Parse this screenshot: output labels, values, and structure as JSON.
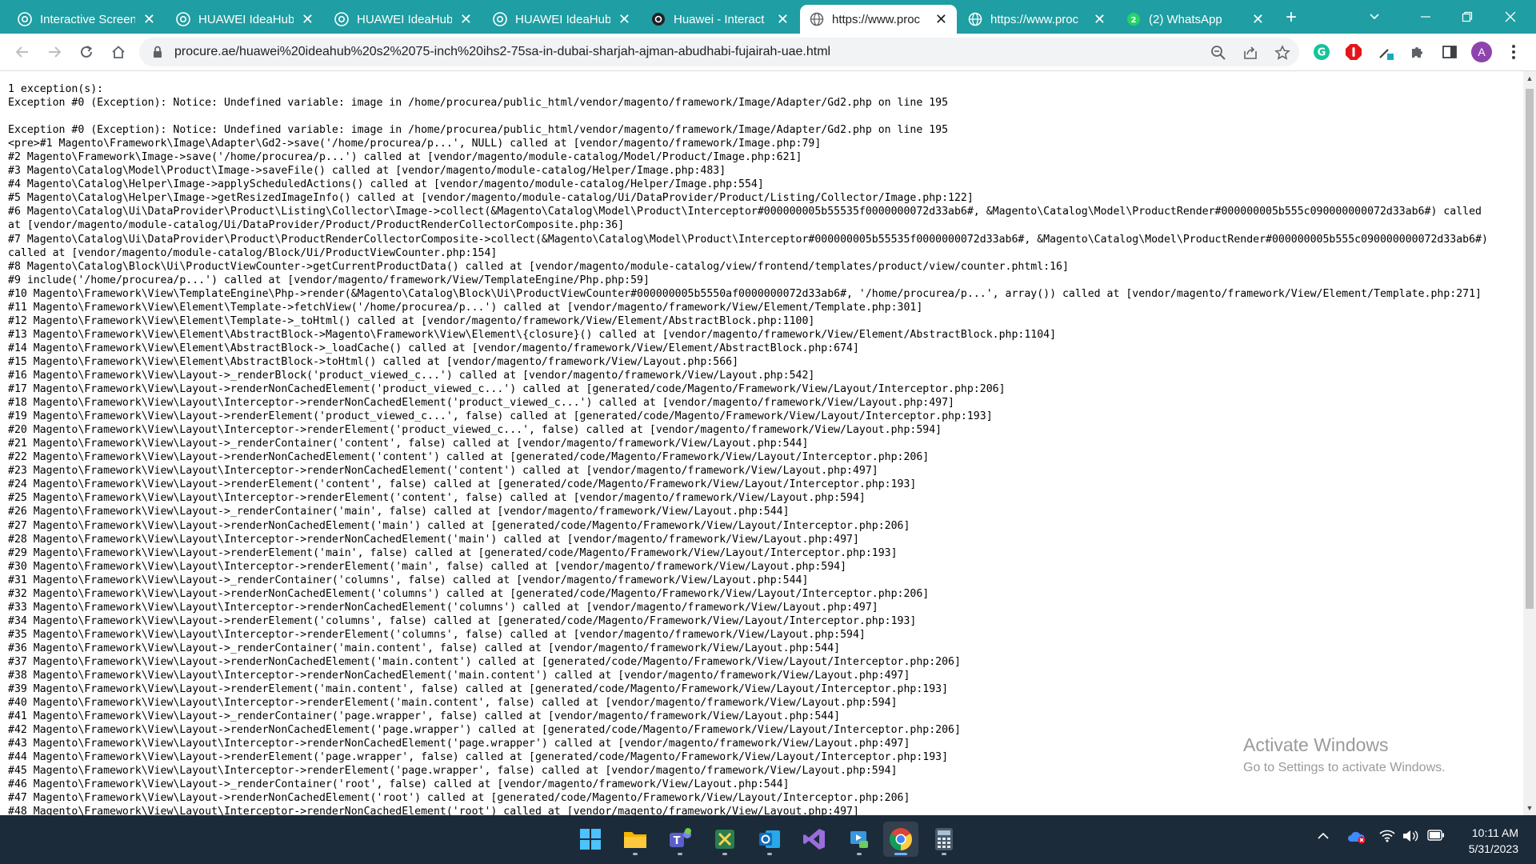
{
  "browser": {
    "tabs": [
      {
        "title": "Interactive Screen",
        "favicon": "chrome-icon",
        "active": false
      },
      {
        "title": "HUAWEI IdeaHub",
        "favicon": "chrome-icon",
        "active": false
      },
      {
        "title": "HUAWEI IdeaHub",
        "favicon": "chrome-icon",
        "active": false
      },
      {
        "title": "HUAWEI IdeaHub",
        "favicon": "chrome-icon",
        "active": false
      },
      {
        "title": "Huawei - Interact",
        "favicon": "site-icon",
        "active": false
      },
      {
        "title": "https://www.proc",
        "favicon": "globe-icon",
        "active": true
      },
      {
        "title": "https://www.proc",
        "favicon": "globe-icon",
        "active": false
      },
      {
        "title": "(2) WhatsApp",
        "favicon": "whatsapp-icon",
        "active": false
      }
    ],
    "new_tab_label": "+",
    "tab_close_glyph": "✕",
    "address": "procure.ae/huawei%20ideahub%20s2%2075-inch%20ihs2-75sa-in-dubai-sharjah-ajman-abudhabi-fujairah-uae.html",
    "profile_initial": "A"
  },
  "page": {
    "lines": [
      "1 exception(s):",
      "Exception #0 (Exception): Notice: Undefined variable: image in /home/procurea/public_html/vendor/magento/framework/Image/Adapter/Gd2.php on line 195",
      "",
      "Exception #0 (Exception): Notice: Undefined variable: image in /home/procurea/public_html/vendor/magento/framework/Image/Adapter/Gd2.php on line 195",
      "<pre>#1 Magento\\Framework\\Image\\Adapter\\Gd2->save('/home/procurea/p...', NULL) called at [vendor/magento/framework/Image.php:79]",
      "#2 Magento\\Framework\\Image->save('/home/procurea/p...') called at [vendor/magento/module-catalog/Model/Product/Image.php:621]",
      "#3 Magento\\Catalog\\Model\\Product\\Image->saveFile() called at [vendor/magento/module-catalog/Helper/Image.php:483]",
      "#4 Magento\\Catalog\\Helper\\Image->applyScheduledActions() called at [vendor/magento/module-catalog/Helper/Image.php:554]",
      "#5 Magento\\Catalog\\Helper\\Image->getResizedImageInfo() called at [vendor/magento/module-catalog/Ui/DataProvider/Product/Listing/Collector/Image.php:122]",
      "#6 Magento\\Catalog\\Ui\\DataProvider\\Product\\Listing\\Collector\\Image->collect(&Magento\\Catalog\\Model\\Product\\Interceptor#000000005b55535f0000000072d33ab6#, &Magento\\Catalog\\Model\\ProductRender#000000005b555c090000000072d33ab6#) called",
      "at [vendor/magento/module-catalog/Ui/DataProvider/Product/ProductRenderCollectorComposite.php:36]",
      "#7 Magento\\Catalog\\Ui\\DataProvider\\Product\\ProductRenderCollectorComposite->collect(&Magento\\Catalog\\Model\\Product\\Interceptor#000000005b55535f0000000072d33ab6#, &Magento\\Catalog\\Model\\ProductRender#000000005b555c090000000072d33ab6#)",
      "called at [vendor/magento/module-catalog/Block/Ui/ProductViewCounter.php:154]",
      "#8 Magento\\Catalog\\Block\\Ui\\ProductViewCounter->getCurrentProductData() called at [vendor/magento/module-catalog/view/frontend/templates/product/view/counter.phtml:16]",
      "#9 include('/home/procurea/p...') called at [vendor/magento/framework/View/TemplateEngine/Php.php:59]",
      "#10 Magento\\Framework\\View\\TemplateEngine\\Php->render(&Magento\\Catalog\\Block\\Ui\\ProductViewCounter#000000005b5550af0000000072d33ab6#, '/home/procurea/p...', array()) called at [vendor/magento/framework/View/Element/Template.php:271]",
      "#11 Magento\\Framework\\View\\Element\\Template->fetchView('/home/procurea/p...') called at [vendor/magento/framework/View/Element/Template.php:301]",
      "#12 Magento\\Framework\\View\\Element\\Template->_toHtml() called at [vendor/magento/framework/View/Element/AbstractBlock.php:1100]",
      "#13 Magento\\Framework\\View\\Element\\AbstractBlock->Magento\\Framework\\View\\Element\\{closure}() called at [vendor/magento/framework/View/Element/AbstractBlock.php:1104]",
      "#14 Magento\\Framework\\View\\Element\\AbstractBlock->_loadCache() called at [vendor/magento/framework/View/Element/AbstractBlock.php:674]",
      "#15 Magento\\Framework\\View\\Element\\AbstractBlock->toHtml() called at [vendor/magento/framework/View/Layout.php:566]",
      "#16 Magento\\Framework\\View\\Layout->_renderBlock('product_viewed_c...') called at [vendor/magento/framework/View/Layout.php:542]",
      "#17 Magento\\Framework\\View\\Layout->renderNonCachedElement('product_viewed_c...') called at [generated/code/Magento/Framework/View/Layout/Interceptor.php:206]",
      "#18 Magento\\Framework\\View\\Layout\\Interceptor->renderNonCachedElement('product_viewed_c...') called at [vendor/magento/framework/View/Layout.php:497]",
      "#19 Magento\\Framework\\View\\Layout->renderElement('product_viewed_c...', false) called at [generated/code/Magento/Framework/View/Layout/Interceptor.php:193]",
      "#20 Magento\\Framework\\View\\Layout\\Interceptor->renderElement('product_viewed_c...', false) called at [vendor/magento/framework/View/Layout.php:594]",
      "#21 Magento\\Framework\\View\\Layout->_renderContainer('content', false) called at [vendor/magento/framework/View/Layout.php:544]",
      "#22 Magento\\Framework\\View\\Layout->renderNonCachedElement('content') called at [generated/code/Magento/Framework/View/Layout/Interceptor.php:206]",
      "#23 Magento\\Framework\\View\\Layout\\Interceptor->renderNonCachedElement('content') called at [vendor/magento/framework/View/Layout.php:497]",
      "#24 Magento\\Framework\\View\\Layout->renderElement('content', false) called at [generated/code/Magento/Framework/View/Layout/Interceptor.php:193]",
      "#25 Magento\\Framework\\View\\Layout\\Interceptor->renderElement('content', false) called at [vendor/magento/framework/View/Layout.php:594]",
      "#26 Magento\\Framework\\View\\Layout->_renderContainer('main', false) called at [vendor/magento/framework/View/Layout.php:544]",
      "#27 Magento\\Framework\\View\\Layout->renderNonCachedElement('main') called at [generated/code/Magento/Framework/View/Layout/Interceptor.php:206]",
      "#28 Magento\\Framework\\View\\Layout\\Interceptor->renderNonCachedElement('main') called at [vendor/magento/framework/View/Layout.php:497]",
      "#29 Magento\\Framework\\View\\Layout->renderElement('main', false) called at [generated/code/Magento/Framework/View/Layout/Interceptor.php:193]",
      "#30 Magento\\Framework\\View\\Layout\\Interceptor->renderElement('main', false) called at [vendor/magento/framework/View/Layout.php:594]",
      "#31 Magento\\Framework\\View\\Layout->_renderContainer('columns', false) called at [vendor/magento/framework/View/Layout.php:544]",
      "#32 Magento\\Framework\\View\\Layout->renderNonCachedElement('columns') called at [generated/code/Magento/Framework/View/Layout/Interceptor.php:206]",
      "#33 Magento\\Framework\\View\\Layout\\Interceptor->renderNonCachedElement('columns') called at [vendor/magento/framework/View/Layout.php:497]",
      "#34 Magento\\Framework\\View\\Layout->renderElement('columns', false) called at [generated/code/Magento/Framework/View/Layout/Interceptor.php:193]",
      "#35 Magento\\Framework\\View\\Layout\\Interceptor->renderElement('columns', false) called at [vendor/magento/framework/View/Layout.php:594]",
      "#36 Magento\\Framework\\View\\Layout->_renderContainer('main.content', false) called at [vendor/magento/framework/View/Layout.php:544]",
      "#37 Magento\\Framework\\View\\Layout->renderNonCachedElement('main.content') called at [generated/code/Magento/Framework/View/Layout/Interceptor.php:206]",
      "#38 Magento\\Framework\\View\\Layout\\Interceptor->renderNonCachedElement('main.content') called at [vendor/magento/framework/View/Layout.php:497]",
      "#39 Magento\\Framework\\View\\Layout->renderElement('main.content', false) called at [generated/code/Magento/Framework/View/Layout/Interceptor.php:193]",
      "#40 Magento\\Framework\\View\\Layout\\Interceptor->renderElement('main.content', false) called at [vendor/magento/framework/View/Layout.php:594]",
      "#41 Magento\\Framework\\View\\Layout->_renderContainer('page.wrapper', false) called at [vendor/magento/framework/View/Layout.php:544]",
      "#42 Magento\\Framework\\View\\Layout->renderNonCachedElement('page.wrapper') called at [generated/code/Magento/Framework/View/Layout/Interceptor.php:206]",
      "#43 Magento\\Framework\\View\\Layout\\Interceptor->renderNonCachedElement('page.wrapper') called at [vendor/magento/framework/View/Layout.php:497]",
      "#44 Magento\\Framework\\View\\Layout->renderElement('page.wrapper', false) called at [generated/code/Magento/Framework/View/Layout/Interceptor.php:193]",
      "#45 Magento\\Framework\\View\\Layout\\Interceptor->renderElement('page.wrapper', false) called at [vendor/magento/framework/View/Layout.php:594]",
      "#46 Magento\\Framework\\View\\Layout->_renderContainer('root', false) called at [vendor/magento/framework/View/Layout.php:544]",
      "#47 Magento\\Framework\\View\\Layout->renderNonCachedElement('root') called at [generated/code/Magento/Framework/View/Layout/Interceptor.php:206]",
      "#48 Magento\\Framework\\View\\Layout\\Interceptor->renderNonCachedElement('root') called at [vendor/magento/framework/View/Layout.php:497]"
    ]
  },
  "watermark": {
    "line1": "Activate Windows",
    "line2": "Go to Settings to activate Windows."
  },
  "taskbar": {
    "apps": [
      {
        "name": "start-button",
        "icon": "windows-logo-icon",
        "active": false
      },
      {
        "name": "file-explorer",
        "icon": "folder-icon",
        "active": false
      },
      {
        "name": "teams",
        "icon": "teams-icon",
        "active": false
      },
      {
        "name": "snip-tool",
        "icon": "snip-icon",
        "active": false
      },
      {
        "name": "outlook",
        "icon": "outlook-icon",
        "active": false
      },
      {
        "name": "visual-studio",
        "icon": "visual-studio-icon",
        "active": false
      },
      {
        "name": "media-player",
        "icon": "media-icon",
        "active": false
      },
      {
        "name": "chrome",
        "icon": "chrome-icon",
        "active": true
      },
      {
        "name": "calculator",
        "icon": "calculator-icon",
        "active": false
      }
    ],
    "time": "10:11 AM",
    "date": "5/31/2023"
  },
  "colors": {
    "tabstrip": "#1f9ea3",
    "taskbar": "#1c2b3a"
  }
}
